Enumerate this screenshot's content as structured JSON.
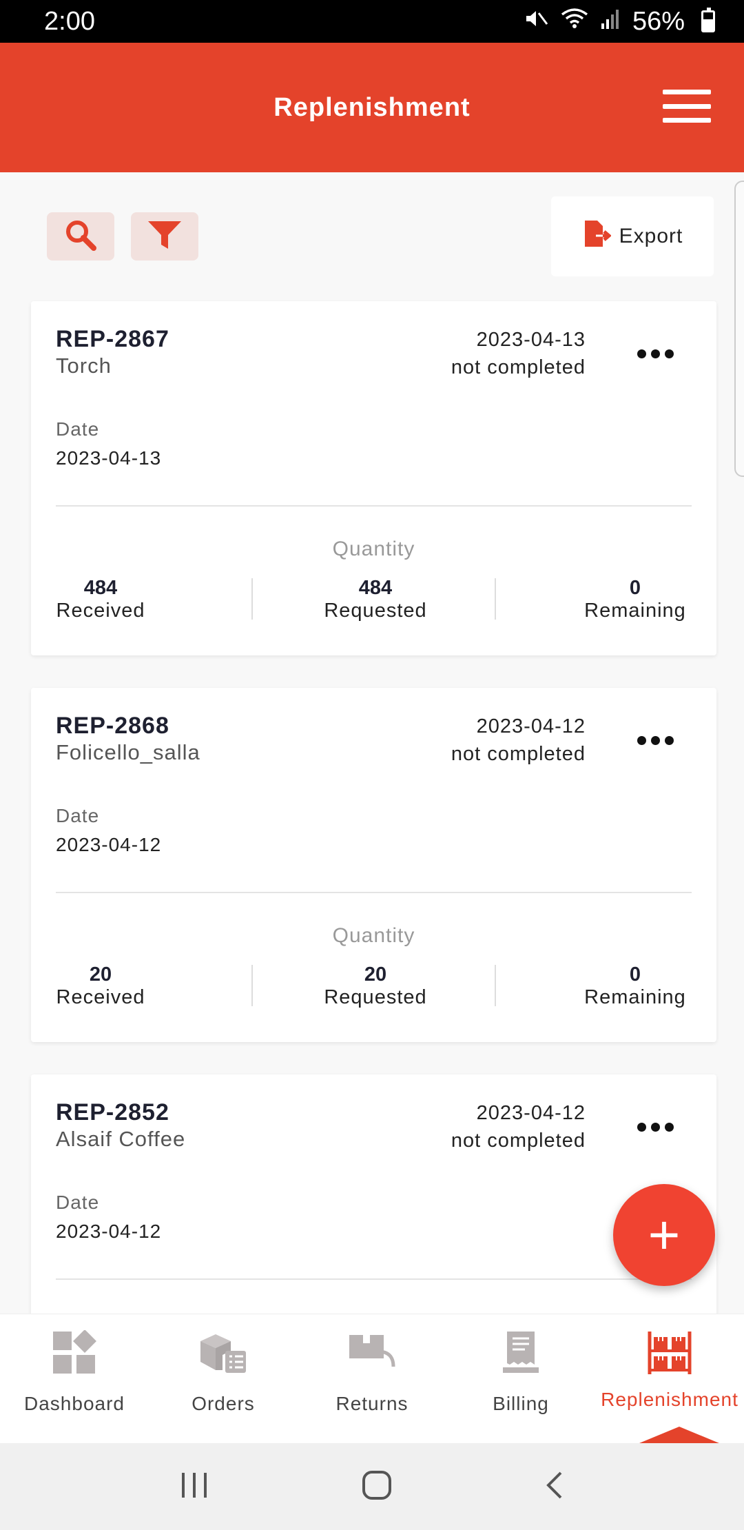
{
  "status_bar": {
    "time": "2:00",
    "battery": "56%"
  },
  "header": {
    "title": "Replenishment"
  },
  "toolbar": {
    "export_label": "Export"
  },
  "cards": [
    {
      "ref": "REP-2867",
      "name": "Torch",
      "date": "2023-04-13",
      "status": "not completed",
      "date_label": "Date",
      "date_value": "2023-04-13",
      "quantity_title": "Quantity",
      "received": "484",
      "received_label": "Received",
      "requested": "484",
      "requested_label": "Requested",
      "remaining": "0",
      "remaining_label": "Remaining"
    },
    {
      "ref": "REP-2868",
      "name": "Folicello_salla",
      "date": "2023-04-12",
      "status": "not completed",
      "date_label": "Date",
      "date_value": "2023-04-12",
      "quantity_title": "Quantity",
      "received": "20",
      "received_label": "Received",
      "requested": "20",
      "requested_label": "Requested",
      "remaining": "0",
      "remaining_label": "Remaining"
    },
    {
      "ref": "REP-2852",
      "name": "Alsaif Coffee",
      "date": "2023-04-12",
      "status": "not completed",
      "date_label": "Date",
      "date_value": "2023-04-12"
    }
  ],
  "fab": {
    "label": "+"
  },
  "bottom_nav": {
    "items": [
      {
        "label": "Dashboard",
        "icon": "dashboard-icon"
      },
      {
        "label": "Orders",
        "icon": "orders-icon"
      },
      {
        "label": "Returns",
        "icon": "returns-icon"
      },
      {
        "label": "Billing",
        "icon": "billing-icon"
      },
      {
        "label": "Replenishment",
        "icon": "replenishment-icon"
      }
    ],
    "active": "Replenishment"
  },
  "colors": {
    "brand": "#e4432b",
    "fab": "#f04331",
    "muted_icon": "#b8b3b3"
  }
}
